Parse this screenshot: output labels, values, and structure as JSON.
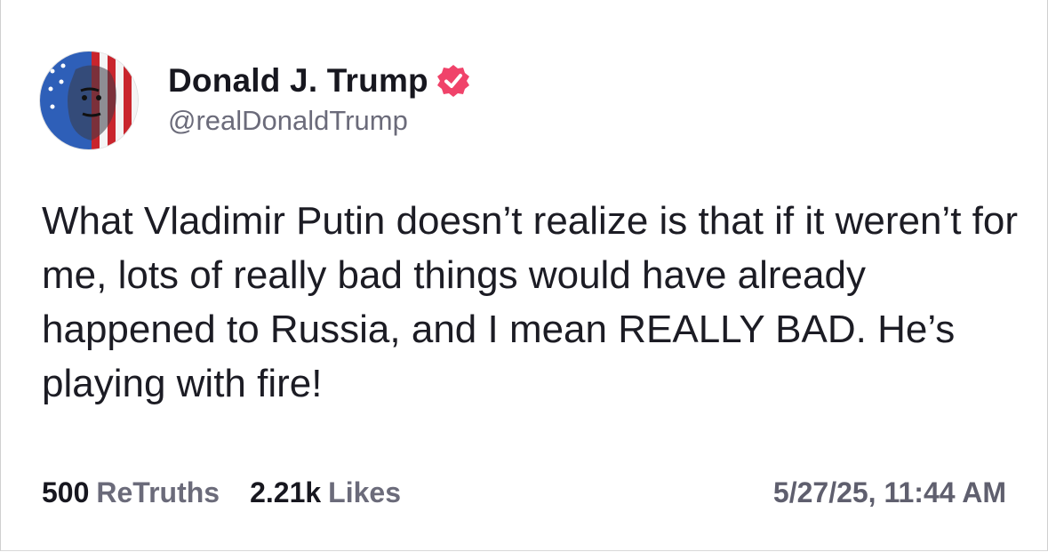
{
  "post": {
    "author": {
      "display_name": "Donald J. Trump",
      "handle": "@realDonaldTrump",
      "verified": true,
      "avatar_icon": "profile-avatar",
      "verified_icon": "verified-badge-icon",
      "verified_color": "#f0436a"
    },
    "text": "What Vladimir Putin doesn’t realize is that if it weren’t for me, lots of really bad things would have already happened to Russia, and I mean REALLY BAD. He’s playing with fire!",
    "stats": {
      "retruths_count": "500",
      "retruths_label": "ReTruths",
      "likes_count": "2.21k",
      "likes_label": "Likes"
    },
    "timestamp": "5/27/25, 11:44 AM"
  }
}
